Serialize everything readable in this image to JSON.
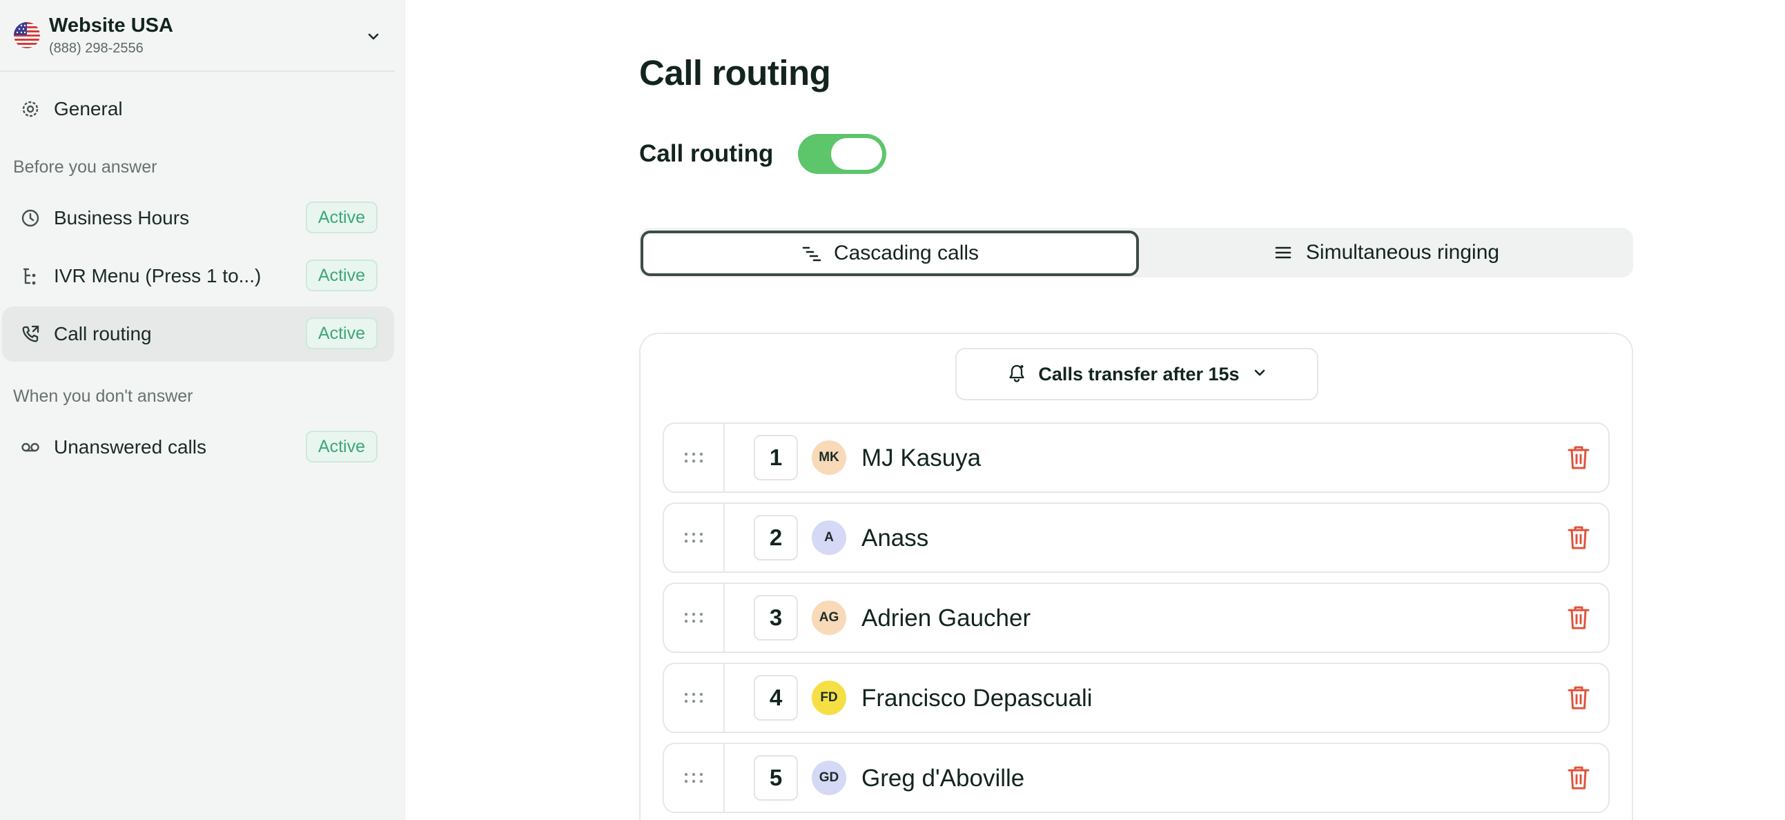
{
  "workspace": {
    "name": "Website USA",
    "phone": "(888) 298-2556",
    "flag_icon": "us-flag-icon"
  },
  "sidebar": {
    "general_label": "General",
    "section_before": "Before you answer",
    "section_after": "When you don't answer",
    "items": [
      {
        "label": "Business Hours",
        "badge": "Active",
        "icon": "clock-icon"
      },
      {
        "label": "IVR Menu (Press 1 to...)",
        "badge": "Active",
        "icon": "ivr-tree-icon"
      },
      {
        "label": "Call routing",
        "badge": "Active",
        "icon": "phone-forward-icon",
        "selected": true
      },
      {
        "label": "Unanswered calls",
        "badge": "Active",
        "icon": "voicemail-icon"
      }
    ]
  },
  "main": {
    "title": "Call routing",
    "toggle_label": "Call routing",
    "toggle_on": true,
    "tabs": [
      {
        "label": "Cascading calls",
        "active": true
      },
      {
        "label": "Simultaneous ringing",
        "active": false
      }
    ],
    "transfer_label": "Calls transfer after 15s",
    "members": [
      {
        "order": "1",
        "initials": "MK",
        "name": "MJ Kasuya",
        "avatar_color": "#f8d9b8"
      },
      {
        "order": "2",
        "initials": "A",
        "name": "Anass",
        "avatar_color": "#d5d9f6"
      },
      {
        "order": "3",
        "initials": "AG",
        "name": "Adrien Gaucher",
        "avatar_color": "#f8d9b8"
      },
      {
        "order": "4",
        "initials": "FD",
        "name": "Francisco Depascuali",
        "avatar_color": "#f5df45"
      },
      {
        "order": "5",
        "initials": "GD",
        "name": "Greg d'Aboville",
        "avatar_color": "#d5d9f6"
      }
    ]
  },
  "colors": {
    "accent_green": "#5dc56a",
    "badge_text": "#3aa877",
    "delete_red": "#e0533b"
  }
}
